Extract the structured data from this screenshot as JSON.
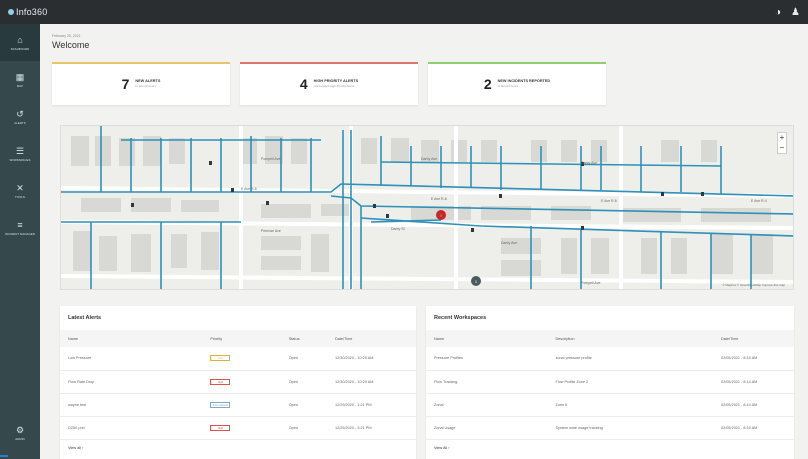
{
  "topbar": {
    "logo": "Info360",
    "help_icon": "help-icon",
    "user_icon": "user-icon"
  },
  "sidebar": {
    "items": [
      {
        "label": "Dashboard",
        "icon": "dashboard-icon"
      },
      {
        "label": "Map",
        "icon": "map-icon"
      },
      {
        "label": "Alerts",
        "icon": "alerts-icon"
      },
      {
        "label": "Workspaces",
        "icon": "workspaces-icon"
      },
      {
        "label": "Tools",
        "icon": "tools-icon"
      },
      {
        "label": "Incident Manager",
        "icon": "incident-icon"
      }
    ],
    "bottom": {
      "label": "Admin",
      "icon": "settings-icon"
    }
  },
  "header": {
    "date": "February 25, 2021",
    "title": "Welcome"
  },
  "cards": [
    {
      "value": "7",
      "title": "New Alerts",
      "sub": "In last 24 hours",
      "color": "#e9c46a"
    },
    {
      "value": "4",
      "title": "High Priority Alerts",
      "sub": "Unresolved High Priority Alerts",
      "color": "#d9776b"
    },
    {
      "value": "2",
      "title": "New Incidents Reported",
      "sub": "In last 24 hours",
      "color": "#8fcf6f"
    }
  ],
  "map": {
    "zoom_in": "+",
    "zoom_out": "−",
    "attribution": "© Mapbox © OpenStreetMap  Improve this map",
    "marker_count": "1",
    "street_labels": [
      "Pompeii Ave",
      "Darby Ave",
      "Darby Ave",
      "E Ave R-6",
      "E Ave R-6",
      "E Ave R-6",
      "E Ave R-4",
      "Penrose Ave",
      "Darby St",
      "Darby Ave",
      "Pompeii Ave"
    ]
  },
  "alerts": {
    "title": "Latest Alerts",
    "columns": [
      "Name",
      "Priority",
      "Status",
      "Date/Time"
    ],
    "rows": [
      {
        "name": "Low Pressure",
        "priority": "Low",
        "priority_color": "#e0b040",
        "status": "Open",
        "date": "12/30/2020 - 10:25 AM"
      },
      {
        "name": "Flow Rate Drop",
        "priority": "High",
        "priority_color": "#d9534f",
        "status": "Open",
        "date": "12/30/2020 - 10:20 AM"
      },
      {
        "name": "wayne test",
        "priority": "Informational",
        "priority_color": "#7fa8c8",
        "status": "Open",
        "date": "12/29/2020 - 1:21 PM"
      },
      {
        "name": "DZ50 prel",
        "priority": "High",
        "priority_color": "#d9534f",
        "status": "Open",
        "date": "12/25/2020 - 3:21 PM"
      }
    ],
    "view_all": "View all  ›"
  },
  "workspaces": {
    "title": "Recent Workspaces",
    "columns": [
      "Name",
      "Description",
      "Date/Time"
    ],
    "rows": [
      {
        "name": "Pressure Profiles",
        "desc": "zonal pressure profile",
        "date": "02/05/2021 - 8:15 AM"
      },
      {
        "name": "Flow Tracking",
        "desc": "Flow Profile Zone 2",
        "date": "02/05/2021 - 8:14 AM"
      },
      {
        "name": "Zonal",
        "desc": "Zone 6",
        "date": "02/05/2021 - 8:14 AM"
      },
      {
        "name": "Zonal Usage",
        "desc": "System wide usage tracking",
        "date": "02/05/2021 - 8:15 AM"
      }
    ],
    "view_all": "View All  ›"
  }
}
